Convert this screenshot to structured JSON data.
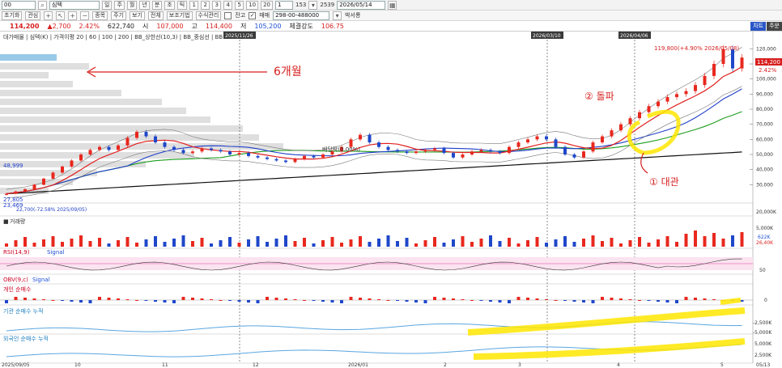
{
  "toolbar": {
    "code": "00",
    "stock_name": "심텍",
    "period_buttons": [
      "일",
      "주",
      "월",
      "년",
      "분",
      "초",
      "틱"
    ],
    "interval_buttons": [
      "1",
      "2",
      "3",
      "4",
      "5",
      "10",
      "20"
    ],
    "count_value": "1",
    "display_count": "153",
    "total_count": "2539",
    "date_value": "2026/05/14",
    "row2_buttons": [
      "초기화",
      "관심",
      "종목",
      "주기",
      "보기",
      "전체"
    ],
    "settings_label": "보조기법",
    "formula_label": "수식관리",
    "check1_label": "잔고",
    "check2_label": "매매",
    "account_value": "298-00-488000",
    "user_label": "박서룡"
  },
  "pricebar": {
    "price": "114,200",
    "change": "▲2,700",
    "change_pct": "2.42%",
    "volume": "622,740",
    "open_label": "시",
    "open_value": "107,000",
    "high_label": "고",
    "high_value": "114,400",
    "low_label": "저",
    "low_value": "105,200",
    "strength_label": "체결강도",
    "strength_value": "106.75",
    "right_buttons": [
      "차트",
      "주문"
    ]
  },
  "chart_data": {
    "type": "line",
    "title": "",
    "legend_text": "대가매물 | 심텍(K) | 가격이평 20 | 60 | 100 | 200 | BB_상한선(10,3) | BB_중심선 | BB",
    "price_axis_ticks": [
      "120,000",
      "110,000",
      "100,000",
      "90,000",
      "80,000",
      "70,000",
      "60,000",
      "50,000",
      "40,000",
      "30,000"
    ],
    "vertical_markers": [
      "2025/11/26",
      "2026/03/10",
      "2026/04/06"
    ],
    "x_tick_labels": [
      "2025/09/05",
      "10",
      "11",
      "12",
      "2026/01",
      "2",
      "3",
      "4",
      "5",
      "05/13"
    ],
    "ylim": [
      20000,
      125000
    ],
    "last_price_tag": "114,200",
    "last_pct_tag": "2.42%",
    "high_annotation": "119,800(+4.90% 2026/05/08)",
    "left_labels": [
      "48,999",
      "27,805",
      "23,469"
    ],
    "low_annotation": "22,700(-72.58% 2025/09/05)",
    "center_text": "배당락(0.00%)",
    "close_series": [
      24000,
      25500,
      27000,
      30000,
      34000,
      38000,
      42000,
      46000,
      50000,
      53000,
      55000,
      53000,
      56000,
      61000,
      65000,
      62000,
      58000,
      55000,
      53000,
      51000,
      52000,
      54000,
      53000,
      52000,
      50000,
      51000,
      49000,
      48000,
      47000,
      46000,
      45000,
      47000,
      49000,
      48000,
      50000,
      52000,
      55000,
      60000,
      63000,
      58000,
      55000,
      53000,
      52000,
      51000,
      52000,
      53000,
      54000,
      51000,
      48000,
      50000,
      52000,
      53000,
      52000,
      51000,
      55000,
      58000,
      60000,
      62000,
      60000,
      55000,
      50000,
      48000,
      52000,
      58000,
      62000,
      66000,
      70000,
      74000,
      78000,
      82000,
      85000,
      88000,
      90000,
      92000,
      96000,
      102000,
      110000,
      119800,
      107000,
      114200
    ],
    "volume_axis_ticks": [
      "5,000K",
      "20,000K"
    ],
    "volume_labels": [
      "622K",
      "26,40K"
    ],
    "rsi_label": "RSI(14,9)",
    "rsi_signal_label": "Signal",
    "rsi_axis_ticks": [
      "50"
    ],
    "obv_label": "OBV(9,c)",
    "obv_signal_label": "Signal",
    "indiv_label": "개인 순매수",
    "indiv_axis_ticks": [
      "0"
    ],
    "inst_label": "기관 순매수 누적",
    "inst_axis_ticks": [
      "-2,500K",
      "-5,000K"
    ],
    "foreign_label": "외국인 순매수 누적",
    "foreign_axis_ticks": [
      "5,000K",
      "2,500K"
    ]
  },
  "annotations": {
    "six_months": "6개월",
    "breakout": "② 돌파",
    "retest": "① 대관"
  },
  "colors": {
    "up": "#e8281e",
    "down": "#1f47c9",
    "ma20": "#e0201e",
    "ma60": "#1f3fc9",
    "ma100": "#1d9d1d",
    "ma200": "#111111",
    "highlight": "#ffe600"
  }
}
